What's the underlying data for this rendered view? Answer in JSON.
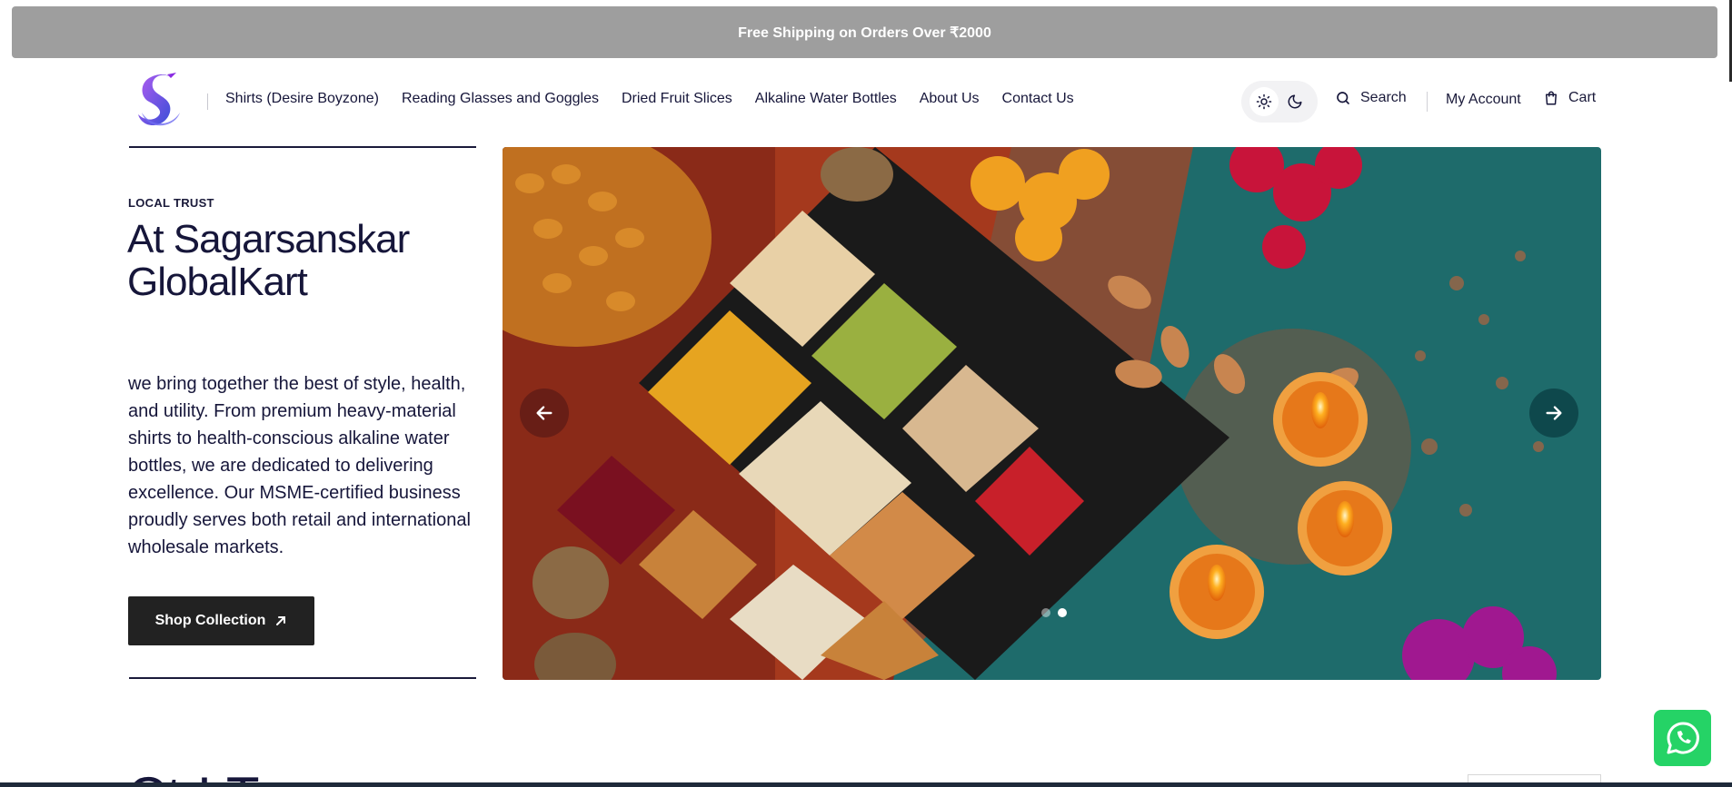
{
  "announcement": {
    "text": "Free Shipping on Orders Over ₹2000"
  },
  "header": {
    "logo_icon": "swan-s-logo",
    "nav": [
      {
        "label": "Shirts (Desire Boyzone)"
      },
      {
        "label": "Reading Glasses and Goggles"
      },
      {
        "label": "Dried Fruit Slices"
      },
      {
        "label": "Alkaline Water Bottles"
      },
      {
        "label": "About Us"
      },
      {
        "label": "Contact Us"
      }
    ],
    "theme_toggle": {
      "light_icon": "sun-icon",
      "dark_icon": "moon-icon",
      "active": "light"
    },
    "search_label": "Search",
    "account_label": "My Account",
    "cart_label": "Cart"
  },
  "hero": {
    "eyebrow": "LOCAL TRUST",
    "title": "At Sagarsanskar GlobalKart",
    "body": "we bring together the best of style, health, and utility. From premium heavy-material shirts to health-conscious alkaline water bottles, we are dedicated to delivering excellence. Our MSME-certified business proudly serves both retail and international wholesale markets.",
    "cta_label": "Shop Collection",
    "cta_icon": "arrow-up-right-icon"
  },
  "slider": {
    "image_subject": "dried fruits tray with diyas and flowers",
    "slide_count": 2,
    "active_slide": 2,
    "prev_icon": "arrow-left-icon",
    "next_icon": "arrow-right-icon"
  },
  "next_section": {
    "title_partial": "Ct    I    T"
  },
  "colors": {
    "announcement_bg": "#9e9e9e",
    "text_primary": "#16163a",
    "button_bg": "#222222",
    "whatsapp_green": "#25d366"
  },
  "floating": {
    "whatsapp_icon": "whatsapp-icon"
  }
}
